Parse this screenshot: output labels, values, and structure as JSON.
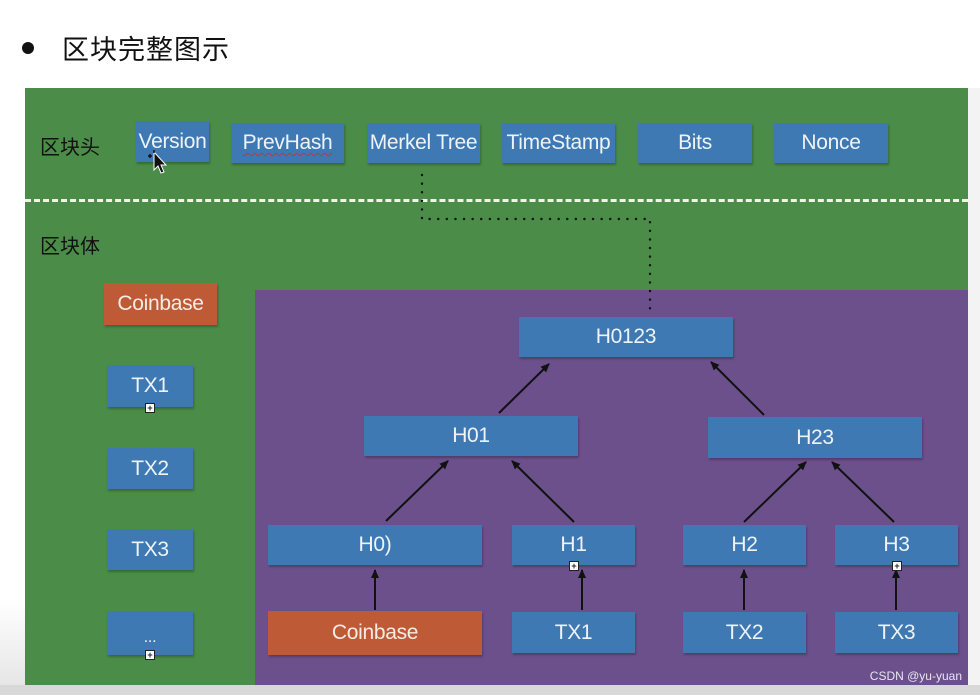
{
  "page": {
    "title": "区块完整图示",
    "watermark": "CSDN @yu-yuan"
  },
  "colors": {
    "block_panel_green": "#4a8c48",
    "merkel_panel_purple": "#6c508c",
    "hash_box_blue": "#3e79b3",
    "coinbase_box_orange": "#bf5a37",
    "arrow_color": "#111111"
  },
  "block_header": {
    "label": "区块头",
    "fields": [
      {
        "label": "Version"
      },
      {
        "label": "PrevHash"
      },
      {
        "label": "Merkel Tree"
      },
      {
        "label": "TimeStamp"
      },
      {
        "label": "Bits"
      },
      {
        "label": "Nonce"
      }
    ]
  },
  "block_body": {
    "label": "区块体",
    "transactions": [
      {
        "label": "Coinbase",
        "type": "coinbase"
      },
      {
        "label": "TX1",
        "type": "tx"
      },
      {
        "label": "TX2",
        "type": "tx"
      },
      {
        "label": "TX3",
        "type": "tx"
      },
      {
        "label": "...",
        "type": "tx"
      }
    ]
  },
  "merkle_tree": {
    "root": {
      "label": "H0123"
    },
    "level1": [
      {
        "label": "H01"
      },
      {
        "label": "H23"
      }
    ],
    "level2": [
      {
        "label": "H0)"
      },
      {
        "label": "H1"
      },
      {
        "label": "H2"
      },
      {
        "label": "H3"
      }
    ],
    "leaves": [
      {
        "label": "Coinbase",
        "type": "coinbase"
      },
      {
        "label": "TX1",
        "type": "tx"
      },
      {
        "label": "TX2",
        "type": "tx"
      },
      {
        "label": "TX3",
        "type": "tx"
      }
    ],
    "edges": [
      {
        "from": "H01",
        "to": "H0123"
      },
      {
        "from": "H23",
        "to": "H0123"
      },
      {
        "from": "H0)",
        "to": "H01"
      },
      {
        "from": "H1",
        "to": "H01"
      },
      {
        "from": "H2",
        "to": "H23"
      },
      {
        "from": "H3",
        "to": "H23"
      },
      {
        "from": "Coinbase",
        "to": "H0)"
      },
      {
        "from": "TX1",
        "to": "H1"
      },
      {
        "from": "TX2",
        "to": "H2"
      },
      {
        "from": "TX3",
        "to": "H3"
      }
    ],
    "link": {
      "from": "Merkel Tree",
      "to": "H0123",
      "style": "dotted"
    }
  }
}
